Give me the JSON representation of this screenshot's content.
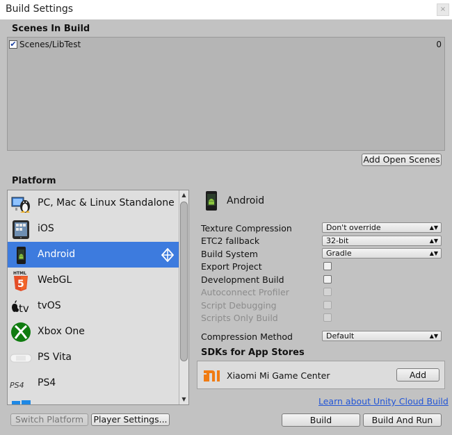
{
  "window": {
    "title": "Build Settings",
    "close_label": "×"
  },
  "scenes": {
    "header": "Scenes In Build",
    "items": [
      {
        "name": "Scenes/LibTest",
        "index": "0",
        "checked": true
      }
    ],
    "add_open_scenes_label": "Add Open Scenes"
  },
  "platform": {
    "header": "Platform",
    "items": [
      {
        "label": "PC, Mac & Linux Standalone",
        "icon": "pc-mac-linux-icon"
      },
      {
        "label": "iOS",
        "icon": "ios-icon"
      },
      {
        "label": "Android",
        "icon": "android-icon",
        "selected": true
      },
      {
        "label": "WebGL",
        "icon": "html5-icon"
      },
      {
        "label": "tvOS",
        "icon": "apple-tv-icon"
      },
      {
        "label": "Xbox One",
        "icon": "xbox-icon"
      },
      {
        "label": "PS Vita",
        "icon": "ps-vita-icon"
      },
      {
        "label": "PS4",
        "icon": "ps4-icon"
      }
    ],
    "selected_color": "#3d7bde",
    "switch_platform_label": "Switch Platform",
    "player_settings_label": "Player Settings..."
  },
  "settings": {
    "title": "Android",
    "texture_compression": {
      "label": "Texture Compression",
      "value": "Don't override"
    },
    "etc2_fallback": {
      "label": "ETC2 fallback",
      "value": "32-bit"
    },
    "build_system": {
      "label": "Build System",
      "value": "Gradle"
    },
    "export_project": {
      "label": "Export Project",
      "checked": false
    },
    "development_build": {
      "label": "Development Build",
      "checked": false
    },
    "autoconnect_profiler": {
      "label": "Autoconnect Profiler",
      "checked": false,
      "disabled": true
    },
    "script_debugging": {
      "label": "Script Debugging",
      "checked": false,
      "disabled": true
    },
    "scripts_only_build": {
      "label": "Scripts Only Build",
      "checked": false,
      "disabled": true
    },
    "compression_method": {
      "label": "Compression Method",
      "value": "Default"
    }
  },
  "sdks": {
    "header": "SDKs for App Stores",
    "items": [
      {
        "name": "Xiaomi Mi Game Center",
        "button": "Add",
        "logo_color": "#f07b12"
      }
    ]
  },
  "footer": {
    "cloud_build_link": "Learn about Unity Cloud Build",
    "build_label": "Build",
    "build_and_run_label": "Build And Run"
  }
}
